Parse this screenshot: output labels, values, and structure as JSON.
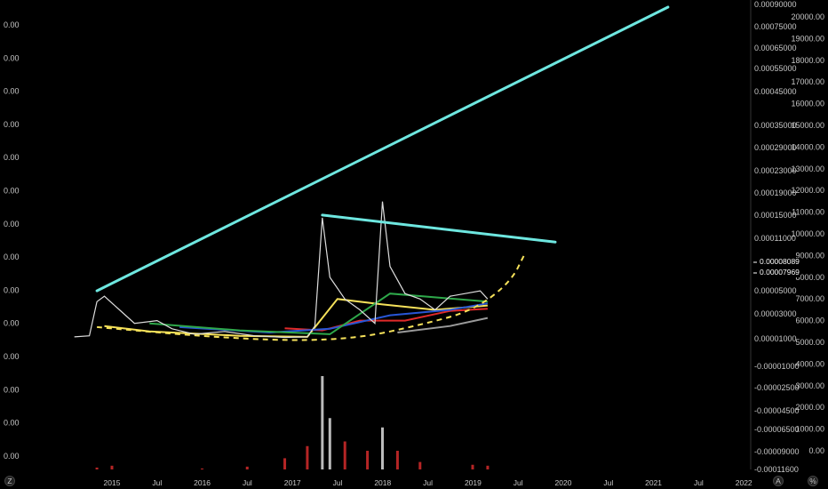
{
  "chart_data": {
    "type": "line",
    "x_ticks": [
      "2015",
      "Jul",
      "2016",
      "Jul",
      "2017",
      "Jul",
      "2018",
      "Jul",
      "2019",
      "Jul",
      "2020",
      "Jul",
      "2021",
      "Jul",
      "2022"
    ],
    "left_axis_ticks": [
      "0.00",
      "0.00",
      "0.00",
      "0.00",
      "0.00",
      "0.00",
      "0.00",
      "0.00",
      "0.00",
      "0.00",
      "0.00",
      "0.00",
      "0.00",
      "0.00"
    ],
    "right_axis_a_ticks": [
      "0.00090000",
      "0.00075000",
      "0.00065000",
      "0.00055000",
      "0.00045000",
      "0.00035000",
      "0.00029000",
      "0.00023000",
      "0.00019000",
      "0.00015000",
      "0.00011000",
      "0.00008089",
      "0.00007969",
      "0.00005000",
      "0.00003000",
      "0.00001000",
      "-0.00001000",
      "-0.00002500",
      "-0.00004500",
      "-0.00006500",
      "-0.00009000",
      "-0.00011600"
    ],
    "right_axis_b_ticks": [
      "20000.00",
      "19000.00",
      "18000.00",
      "17000.00",
      "16000.00",
      "15000.00",
      "14000.00",
      "13000.00",
      "12000.00",
      "11000.00",
      "10000.00",
      "9000.00",
      "8000.00",
      "7000.00",
      "6000.00",
      "5000.00",
      "4000.00",
      "3000.00",
      "2000.00",
      "1000.00",
      "0.00"
    ],
    "price_badges": [
      "0.00008089",
      "0.00007969"
    ],
    "corner_labels": {
      "left": "Z",
      "mid": "A",
      "right": "%"
    },
    "trendlines": [
      {
        "color": "#6ee7e0",
        "from": [
          "2014-11",
          9.5e-05
        ],
        "to": [
          "2021-03",
          0.00079
        ]
      },
      {
        "color": "#6ee7e0",
        "from": [
          "2017-05",
          0.000235
        ],
        "to": [
          "2019-12",
          0.000185
        ]
      }
    ],
    "projection_curve": {
      "color": "#f5e15a",
      "style": "dashed",
      "points": [
        [
          "2014-11",
          2.8e-05
        ],
        [
          "2016-01",
          1.1e-05
        ],
        [
          "2017-01",
          2.5e-06
        ],
        [
          "2017-10",
          8e-06
        ],
        [
          "2018-06",
          3.2e-05
        ],
        [
          "2019-01",
          5.8e-05
        ],
        [
          "2019-06",
          0.00011
        ],
        [
          "2019-08",
          0.000165
        ]
      ]
    },
    "price_series": [
      [
        "2014-08",
        1e-05
      ],
      [
        "2014-10",
        1.2e-05
      ],
      [
        "2014-11",
        7.5e-05
      ],
      [
        "2014-12",
        8.5e-05
      ],
      [
        "2015-02",
        6e-05
      ],
      [
        "2015-04",
        3.5e-05
      ],
      [
        "2015-07",
        4e-05
      ],
      [
        "2015-09",
        2.5e-05
      ],
      [
        "2015-12",
        1.5e-05
      ],
      [
        "2016-04",
        2e-05
      ],
      [
        "2016-08",
        1.2e-05
      ],
      [
        "2016-12",
        9e-06
      ],
      [
        "2017-03",
        1e-05
      ],
      [
        "2017-04",
        3e-05
      ],
      [
        "2017-05",
        0.00023
      ],
      [
        "2017-06",
        0.00012
      ],
      [
        "2017-08",
        8e-05
      ],
      [
        "2017-10",
        6e-05
      ],
      [
        "2017-12",
        3.5e-05
      ],
      [
        "2018-01",
        0.00026
      ],
      [
        "2018-02",
        0.00014
      ],
      [
        "2018-04",
        9e-05
      ],
      [
        "2018-06",
        8e-05
      ],
      [
        "2018-08",
        6e-05
      ],
      [
        "2018-10",
        8.5e-05
      ],
      [
        "2018-12",
        9e-05
      ],
      [
        "2019-02",
        9.5e-05
      ],
      [
        "2019-03",
        8e-05
      ]
    ],
    "moving_averages": [
      {
        "color": "#f5e15a",
        "points": [
          [
            "2014-12",
            3e-05
          ],
          [
            "2015-06",
            2e-05
          ],
          [
            "2016-06",
            1.2e-05
          ],
          [
            "2017-03",
            1e-05
          ],
          [
            "2017-07",
            8e-05
          ],
          [
            "2018-01",
            7e-05
          ],
          [
            "2018-08",
            6e-05
          ],
          [
            "2019-03",
            6.8e-05
          ]
        ]
      },
      {
        "color": "#e12a2a",
        "points": [
          [
            "2016-12",
            2.6e-05
          ],
          [
            "2017-05",
            2.2e-05
          ],
          [
            "2017-10",
            4e-05
          ],
          [
            "2018-04",
            4e-05
          ],
          [
            "2018-10",
            5.8e-05
          ],
          [
            "2019-03",
            6.2e-05
          ]
        ]
      },
      {
        "color": "#2856d6",
        "points": [
          [
            "2015-10",
            2.8e-05
          ],
          [
            "2016-10",
            1.8e-05
          ],
          [
            "2017-06",
            2.5e-05
          ],
          [
            "2018-02",
            5e-05
          ],
          [
            "2018-10",
            6e-05
          ],
          [
            "2019-03",
            7.2e-05
          ]
        ]
      },
      {
        "color": "#2ea84a",
        "points": [
          [
            "2015-06",
            3.5e-05
          ],
          [
            "2016-06",
            2.2e-05
          ],
          [
            "2017-06",
            1.5e-05
          ],
          [
            "2018-02",
            9e-05
          ],
          [
            "2019-03",
            7.5e-05
          ]
        ]
      },
      {
        "color": "#9a9a9a",
        "points": [
          [
            "2018-03",
            1.8e-05
          ],
          [
            "2018-10",
            3e-05
          ],
          [
            "2019-03",
            4.5e-05
          ]
        ]
      }
    ],
    "volume_series": [
      [
        "2014-11",
        0.02
      ],
      [
        "2015-01",
        0.04
      ],
      [
        "2016-01",
        0.01
      ],
      [
        "2016-07",
        0.03
      ],
      [
        "2016-12",
        0.12
      ],
      [
        "2017-03",
        0.25
      ],
      [
        "2017-05",
        1.0
      ],
      [
        "2017-06",
        0.55
      ],
      [
        "2017-08",
        0.3
      ],
      [
        "2017-11",
        0.2
      ],
      [
        "2018-01",
        0.45
      ],
      [
        "2018-03",
        0.2
      ],
      [
        "2018-06",
        0.08
      ],
      [
        "2019-01",
        0.05
      ],
      [
        "2019-03",
        0.04
      ]
    ]
  }
}
